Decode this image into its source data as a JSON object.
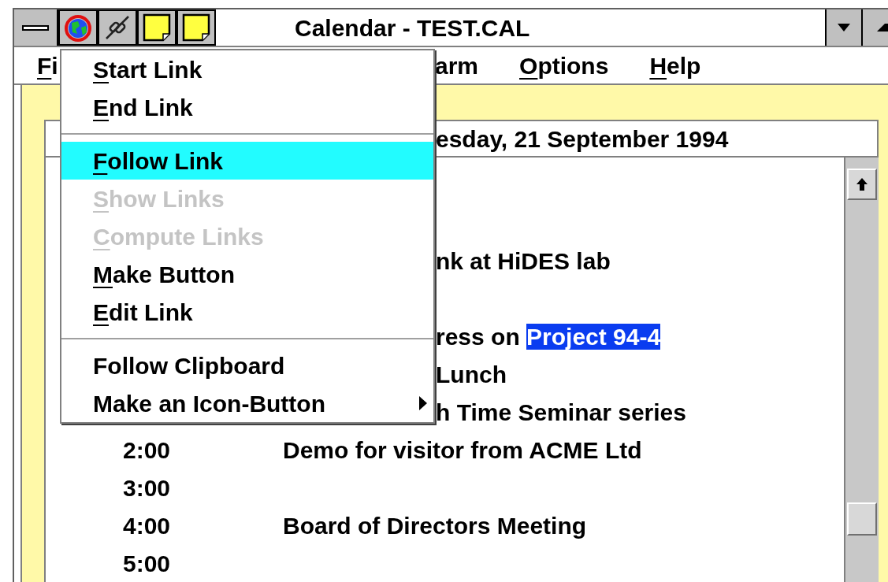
{
  "window": {
    "title": "Calendar - TEST.CAL"
  },
  "menu_bar": {
    "left": [
      {
        "mnemonic": "F",
        "text": "i"
      }
    ],
    "right": [
      {
        "text": "arm"
      },
      {
        "mnemonic": "O",
        "text": "ptions"
      },
      {
        "mnemonic": "H",
        "text": "elp"
      }
    ]
  },
  "date_header": "esday, 21 September 1994",
  "rows": [
    {
      "kind": "blank"
    },
    {
      "kind": "blank"
    },
    {
      "kind": "fragment",
      "segments": [
        {
          "text": "nk at HiDES lab",
          "selected": false
        }
      ]
    },
    {
      "kind": "blank"
    },
    {
      "kind": "fragment",
      "segments": [
        {
          "text": "ress on ",
          "selected": false
        },
        {
          "text": "Project 94-4",
          "selected": true
        }
      ]
    },
    {
      "kind": "fragment",
      "segments": [
        {
          "text": "Lunch",
          "selected": false
        }
      ]
    },
    {
      "kind": "fragment",
      "segments": [
        {
          "text": "h Time Seminar series",
          "selected": false
        }
      ]
    },
    {
      "kind": "entry",
      "time": "2:00",
      "event": "Demo for visitor from ACME Ltd"
    },
    {
      "kind": "entry",
      "time": "3:00"
    },
    {
      "kind": "entry",
      "time": "4:00",
      "event": "Board of Directors Meeting"
    },
    {
      "kind": "entry",
      "time": "5:00"
    }
  ],
  "dropdown_menu": [
    {
      "kind": "item",
      "mnemonic": "S",
      "text": "tart Link",
      "selected": false,
      "disabled": false
    },
    {
      "kind": "item",
      "mnemonic": "E",
      "text": "nd Link",
      "selected": false,
      "disabled": false
    },
    {
      "kind": "separator"
    },
    {
      "kind": "item",
      "mnemonic": "F",
      "text": "ollow Link",
      "selected": true,
      "disabled": false
    },
    {
      "kind": "item",
      "mnemonic": "S",
      "text": "how Links",
      "selected": false,
      "disabled": true
    },
    {
      "kind": "item",
      "mnemonic": "C",
      "text": "ompute Links",
      "selected": false,
      "disabled": true
    },
    {
      "kind": "item",
      "mnemonic": "M",
      "text": "ake Button",
      "selected": false,
      "disabled": false
    },
    {
      "kind": "item",
      "mnemonic": "E",
      "text": "dit Link",
      "selected": false,
      "disabled": false
    },
    {
      "kind": "separator"
    },
    {
      "kind": "item",
      "text": "Follow Clipboard",
      "selected": false,
      "disabled": false
    },
    {
      "kind": "item",
      "text": "Make an Icon-Button",
      "selected": false,
      "disabled": false,
      "submenu": true
    }
  ]
}
